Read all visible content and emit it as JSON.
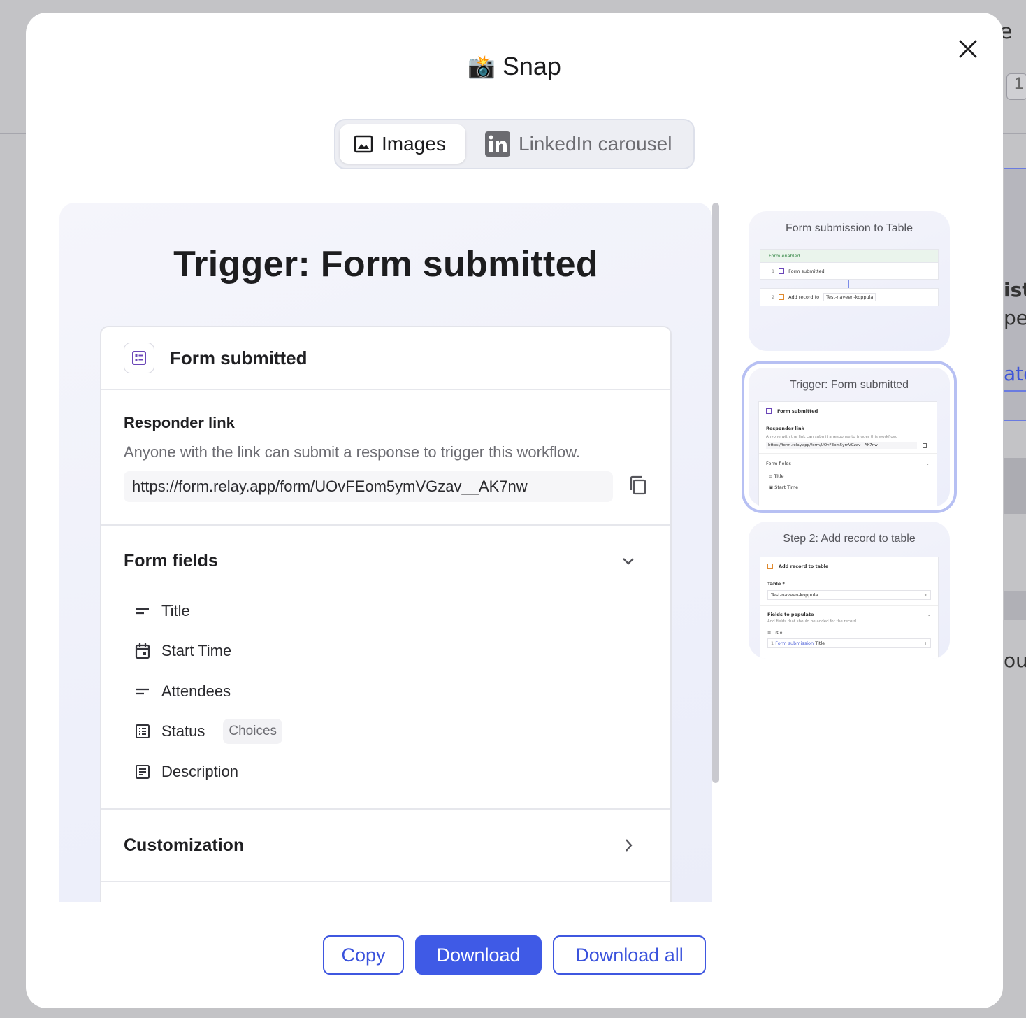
{
  "modal": {
    "title": "Snap",
    "title_emoji": "📸"
  },
  "tabs": [
    {
      "label": "Images",
      "active": true
    },
    {
      "label": "LinkedIn carousel",
      "active": false
    }
  ],
  "preview": {
    "title": "Trigger: Form submitted",
    "card": {
      "header": "Form submitted",
      "responder": {
        "label": "Responder link",
        "description": "Anyone with the link can submit a response to trigger this workflow.",
        "url": "https://form.relay.app/form/UOvFEom5ymVGzav__AK7nw"
      },
      "form_fields": {
        "label": "Form fields",
        "fields": [
          {
            "name": "Title",
            "icon": "text-lines-icon",
            "chip": ""
          },
          {
            "name": "Start Time",
            "icon": "calendar-icon",
            "chip": ""
          },
          {
            "name": "Attendees",
            "icon": "text-lines-icon",
            "chip": ""
          },
          {
            "name": "Status",
            "icon": "list-icon",
            "chip": "Choices"
          },
          {
            "name": "Description",
            "icon": "document-icon",
            "chip": ""
          }
        ]
      },
      "customization": {
        "label": "Customization"
      }
    }
  },
  "thumbnails": [
    {
      "title": "Form submission to Table",
      "enabled_text": "Form enabled",
      "step1_num": "1",
      "step1": "Form submitted",
      "step2_num": "2",
      "step2_prefix": "Add record to",
      "step2_target": "Test-naveen-koppula"
    },
    {
      "title": "Trigger: Form submitted",
      "header": "Form submitted",
      "responder_label": "Responder link",
      "responder_desc": "Anyone with the link can submit a response to trigger this workflow.",
      "url": "https://form.relay.app/form/UOvFEom5ymVGzav__AK7nw",
      "fields_label": "Form fields",
      "field1": "Title",
      "field2": "Start Time"
    },
    {
      "title": "Step 2: Add record to table",
      "header": "Add record to table",
      "table_label": "Table *",
      "table_value": "Test-naveen-koppula",
      "populate_label": "Fields to populate",
      "populate_desc": "Add fields that should be added for the record.",
      "field_label": "Title",
      "field_num": "1",
      "field_source": "Form submission",
      "field_value": "Title"
    }
  ],
  "buttons": {
    "copy": "Copy",
    "download": "Download",
    "download_all": "Download all"
  },
  "background": {
    "frag_top": "e",
    "frag_num": "1",
    "frag_1": "ist",
    "frag_2": "pel",
    "frag_link": "ate",
    "frag_3": "oula"
  },
  "colors": {
    "accent": "#3f5ae6",
    "selected_thumb_border": "#b7c0f3",
    "form_icon": "#6b47b8"
  }
}
